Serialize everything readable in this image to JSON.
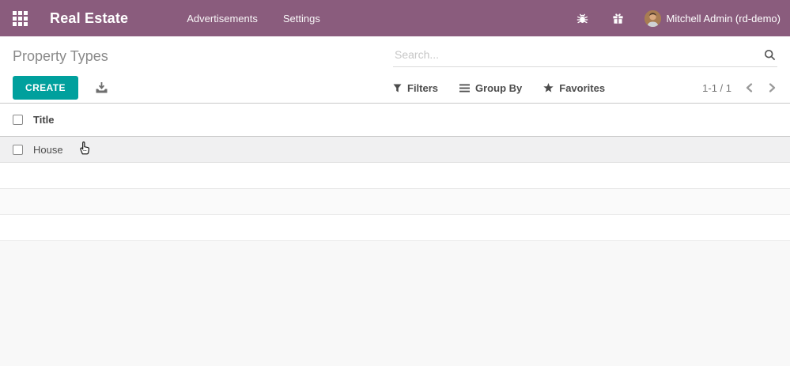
{
  "topbar": {
    "app_title": "Real Estate",
    "menu": [
      {
        "label": "Advertisements"
      },
      {
        "label": "Settings"
      }
    ],
    "user_name": "Mitchell Admin (rd-demo)",
    "icons": [
      "apps-grid-icon",
      "bug-icon",
      "gift-icon",
      "avatar"
    ]
  },
  "control_panel": {
    "breadcrumb": "Property Types",
    "create_label": "CREATE",
    "export_icon": "download-export-icon",
    "search_placeholder": "Search...",
    "filters_label": "Filters",
    "group_by_label": "Group By",
    "favorites_label": "Favorites",
    "pager_text": "1-1 / 1"
  },
  "table": {
    "columns": [
      "Title"
    ],
    "rows": [
      {
        "title": "House"
      }
    ]
  },
  "colors": {
    "topbar_bg": "#8a5c7d",
    "primary_teal": "#00a09d",
    "page_bg": "#f8f8f8",
    "row_hover_bg": "#f0f0f1"
  }
}
